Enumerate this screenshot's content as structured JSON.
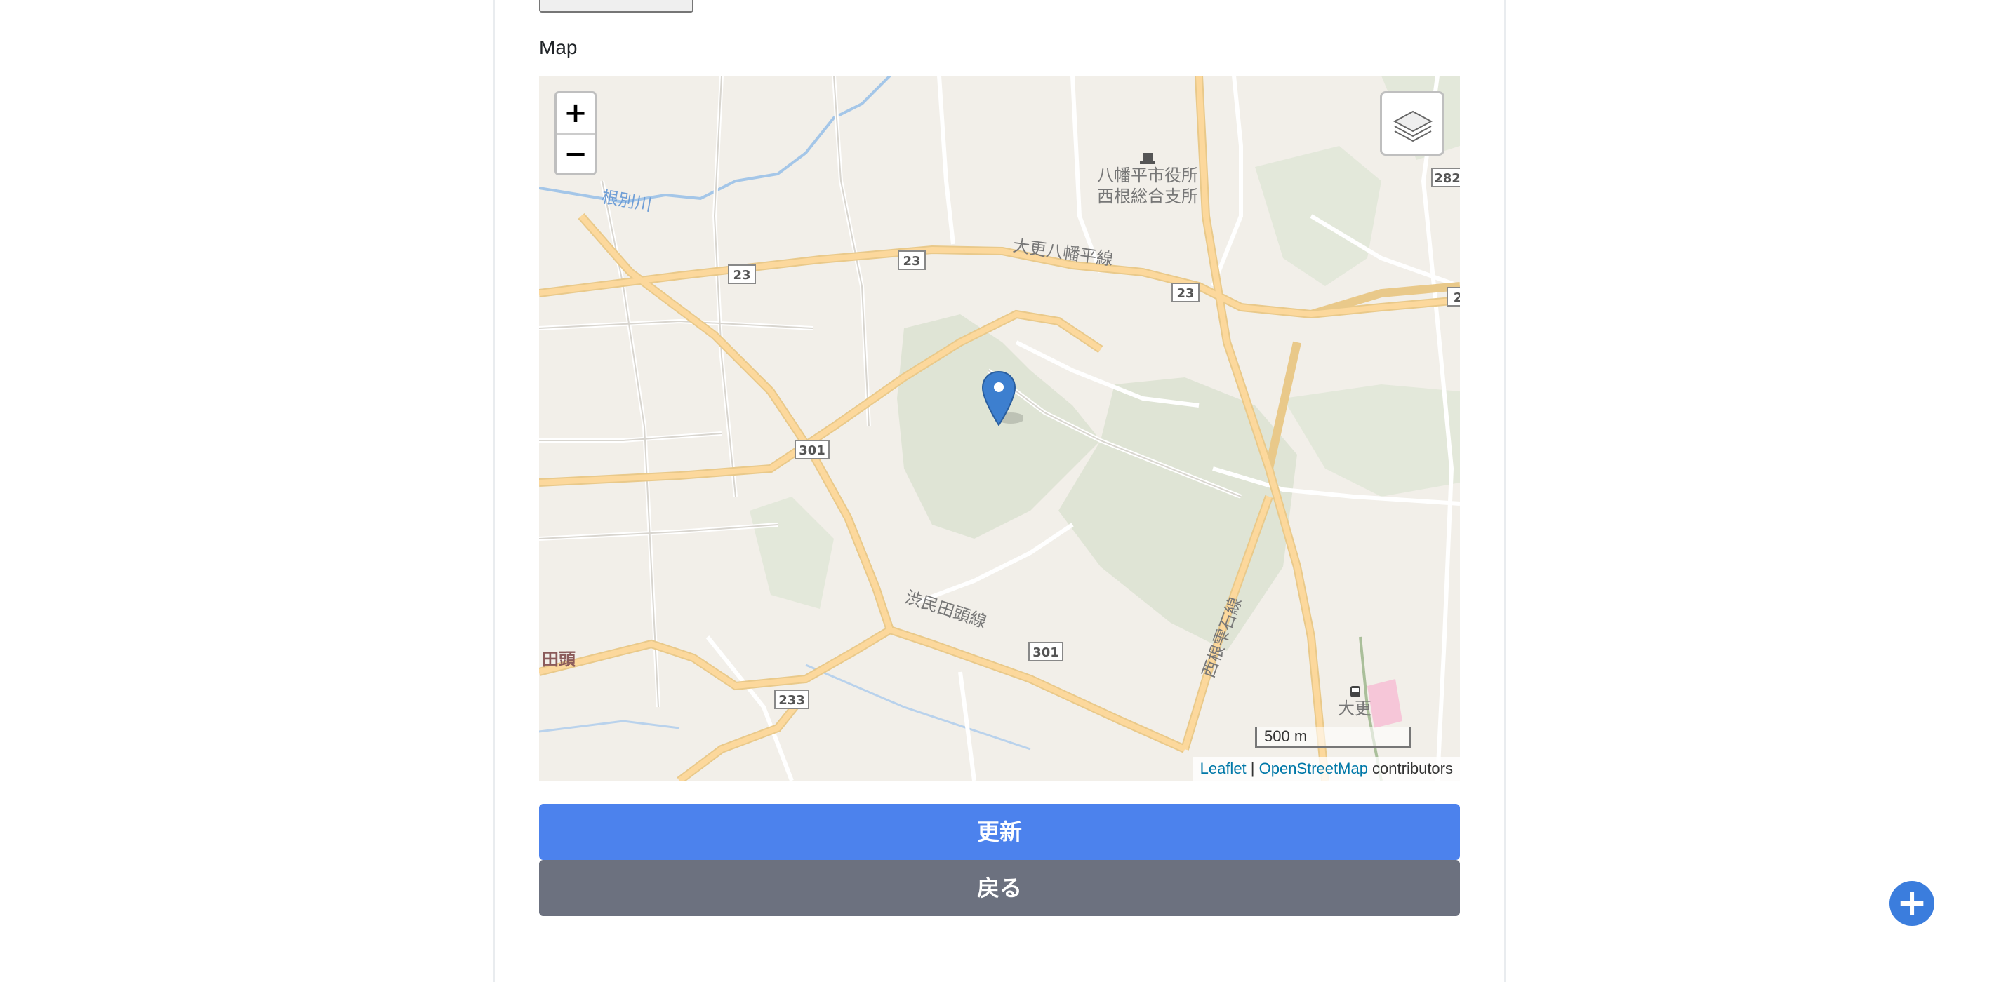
{
  "form": {
    "file_button_label": "",
    "file_status": "",
    "map_label": "Map"
  },
  "map": {
    "zoom_in": "+",
    "zoom_out": "−",
    "scale_label": "500 m",
    "attribution": {
      "leaflet": "Leaflet",
      "separator": " | ",
      "osm": "OpenStreetMap",
      "suffix": " contributors"
    },
    "places": {
      "city_office": "八幡平市役所",
      "branch_office": "西根総合支所",
      "road_ohbuke": "大更八幡平線",
      "road_shibutami": "渋民田頭線",
      "road_nishine": "西根雫石線",
      "river": "根別川",
      "area_tagashira": "田頭",
      "station": "大更"
    },
    "route_numbers": {
      "r23a": "23",
      "r23b": "23",
      "r23c": "23",
      "r301a": "301",
      "r301b": "301",
      "r233": "233",
      "r282": "282",
      "r2": "2"
    }
  },
  "actions": {
    "update": "更新",
    "back": "戻る"
  },
  "colors": {
    "primary": "#4c82ed",
    "secondary": "#6c717f",
    "fab": "#3b7ddd"
  }
}
